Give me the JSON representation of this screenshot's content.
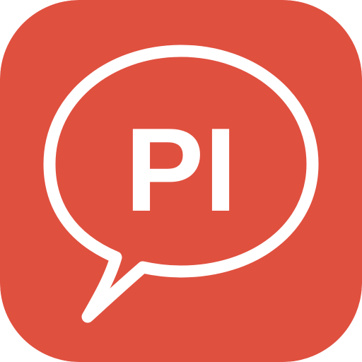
{
  "icon": {
    "name": "speech-bubble-icon",
    "text": "PI",
    "colors": {
      "background": "#E0503F",
      "foreground": "#FFFFFF"
    }
  }
}
